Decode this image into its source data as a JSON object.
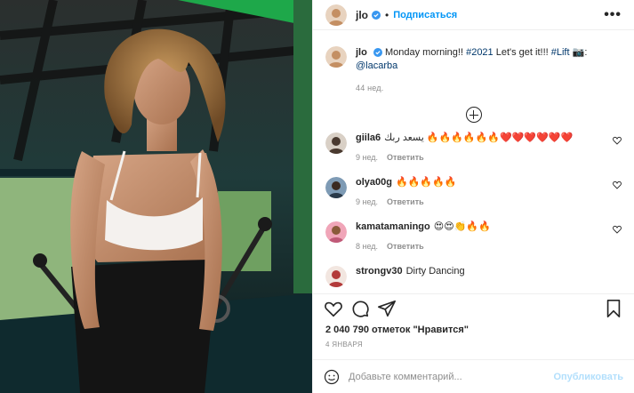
{
  "header": {
    "username": "jlo",
    "separator": "•",
    "follow_label": "Подписаться",
    "more_label": "•••"
  },
  "caption": {
    "username": "jlo",
    "text_before": "Monday morning!! ",
    "hashtag_year": "#2021",
    "text_mid": " Let's get it!!! ",
    "hashtag_lift": "#Lift",
    "camera_emoji": "📷",
    "text_colon": ": ",
    "mention": "@lacarba",
    "time": "44 нед."
  },
  "comments": [
    {
      "username": "giila6",
      "text": "يسعد ربك 🔥🔥🔥🔥🔥🔥❤️❤️❤️❤️❤️❤️",
      "time": "9 нед.",
      "reply_label": "Ответить"
    },
    {
      "username": "olya00g",
      "text": "🔥🔥🔥🔥🔥",
      "time": "9 нед.",
      "reply_label": "Ответить"
    },
    {
      "username": "kamatamaningo",
      "text": "😍😍👏🔥🔥",
      "time": "8 нед.",
      "reply_label": "Ответить"
    },
    {
      "username": "strongv30",
      "text": "Dirty Dancing",
      "time": "",
      "reply_label": ""
    }
  ],
  "likes": "2 040 790 отметок \"Нравится\"",
  "post_date": "4 ЯНВАРЯ",
  "composer": {
    "placeholder": "Добавьте комментарий...",
    "publish_label": "Опубликовать"
  },
  "colors": {
    "accent": "#0095f6",
    "muted": "#8e8e8e",
    "publish_disabled": "#b2dffc"
  }
}
